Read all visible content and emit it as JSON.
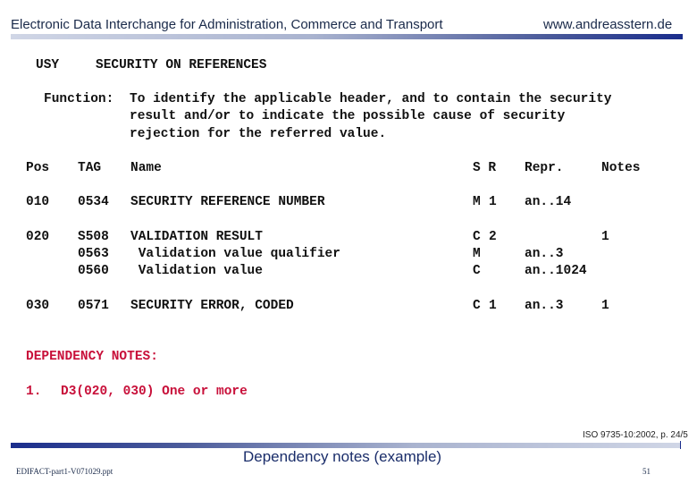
{
  "header": {
    "title": "Electronic Data Interchange for Administration, Commerce and Transport",
    "url": "www.andreasstern.de"
  },
  "segment": {
    "tag": "USY",
    "name": "SECURITY ON REFERENCES",
    "function_label": "Function:",
    "function_lines": [
      "To identify the applicable header, and to contain the security",
      "result and/or to indicate the possible cause of security",
      "rejection for the referred value."
    ]
  },
  "table": {
    "headers": {
      "pos": "Pos",
      "tag": "TAG",
      "name": "Name",
      "sr": "S R",
      "repr": "Repr.",
      "notes": "Notes"
    },
    "rows": [
      {
        "pos": "010",
        "tag": "0534",
        "name": "SECURITY REFERENCE NUMBER",
        "s": "M",
        "r": "1",
        "repr": "an..14",
        "notes": ""
      },
      {
        "pos": "020",
        "tag": "S508",
        "name": "VALIDATION RESULT",
        "s": "C",
        "r": "2",
        "repr": "",
        "notes": "1"
      },
      {
        "pos": "",
        "tag": "0563",
        "name": " Validation value qualifier",
        "s": "M",
        "r": "",
        "repr": "an..3",
        "notes": ""
      },
      {
        "pos": "",
        "tag": "0560",
        "name": " Validation value",
        "s": "C",
        "r": "",
        "repr": "an..1024",
        "notes": ""
      },
      {
        "pos": "030",
        "tag": "0571",
        "name": "SECURITY ERROR, CODED",
        "s": "C",
        "r": "1",
        "repr": "an..3",
        "notes": "1"
      }
    ]
  },
  "dependency": {
    "heading": "DEPENDENCY NOTES:",
    "items": [
      {
        "number": "1.",
        "text": "D3(020, 030) One or more"
      }
    ]
  },
  "footer": {
    "iso_ref": "ISO 9735-10:2002, p. 24/5",
    "slide_title": "Dependency notes (example)",
    "file_name": "EDIFACT-part1-V071029.ppt",
    "page_number": "51"
  }
}
